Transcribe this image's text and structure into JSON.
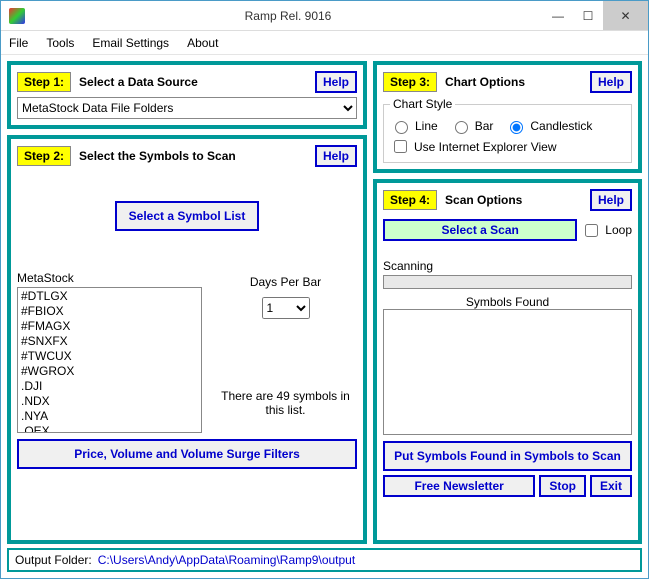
{
  "window": {
    "title": "Ramp Rel. 9016"
  },
  "menu": {
    "file": "File",
    "tools": "Tools",
    "email": "Email Settings",
    "about": "About"
  },
  "step1": {
    "step": "Step 1:",
    "label": "Select a Data Source",
    "help": "Help",
    "source": "MetaStock Data File Folders"
  },
  "step2": {
    "step": "Step 2:",
    "label": "Select the Symbols to Scan",
    "help": "Help",
    "select_btn": "Select a Symbol List",
    "list_caption": "MetaStock",
    "symbols": [
      "#DTLGX",
      "#FBIOX",
      "#FMAGX",
      "#SNXFX",
      "#TWCUX",
      "#WGROX",
      ".DJI",
      ".NDX",
      ".NYA",
      ".OEX"
    ],
    "dpb_label": "Days Per Bar",
    "dpb_value": "1",
    "count_msg": "There are 49 symbols in this list.",
    "filters_btn": "Price, Volume and Volume Surge Filters"
  },
  "step3": {
    "step": "Step 3:",
    "label": "Chart Options",
    "help": "Help",
    "style_legend": "Chart Style",
    "line": "Line",
    "bar": "Bar",
    "candle": "Candlestick",
    "ie_view": "Use Internet Explorer View"
  },
  "step4": {
    "step": "Step 4:",
    "label": "Scan Options",
    "help": "Help",
    "select_scan": "Select a Scan",
    "loop": "Loop",
    "scanning": "Scanning",
    "found_label": "Symbols Found",
    "put_btn": "Put Symbols Found in Symbols to Scan",
    "newsletter": "Free Newsletter",
    "stop": "Stop",
    "exit": "Exit"
  },
  "output": {
    "label": "Output Folder:",
    "path": "C:\\Users\\Andy\\AppData\\Roaming\\Ramp9\\output"
  }
}
